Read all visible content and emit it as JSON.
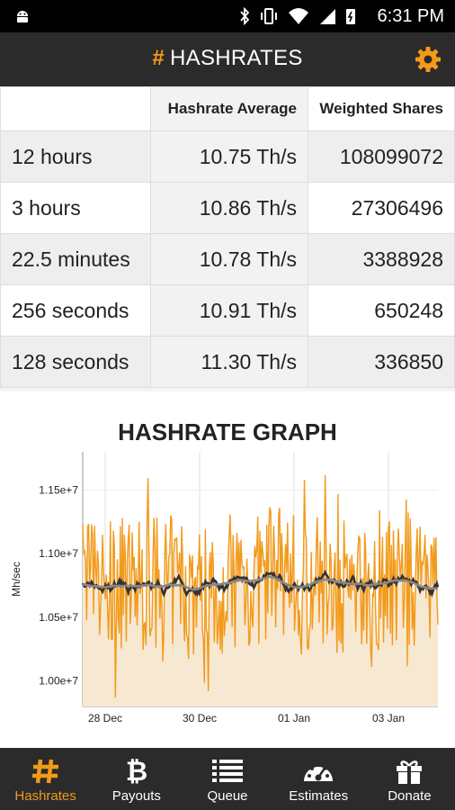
{
  "status_bar": {
    "time": "6:31 PM"
  },
  "app_bar": {
    "title": "HASHRATES",
    "title_icon": "hash"
  },
  "table": {
    "headers": [
      "",
      "Hashrate Average",
      "Weighted Shares"
    ],
    "rows": [
      {
        "period": "12 hours",
        "avg": "10.75 Th/s",
        "shares": "108099072"
      },
      {
        "period": "3 hours",
        "avg": "10.86 Th/s",
        "shares": "27306496"
      },
      {
        "period": "22.5 minutes",
        "avg": "10.78 Th/s",
        "shares": "3388928"
      },
      {
        "period": "256 seconds",
        "avg": "10.91 Th/s",
        "shares": "650248"
      },
      {
        "period": "128 seconds",
        "avg": "11.30 Th/s",
        "shares": "336850"
      }
    ]
  },
  "graph": {
    "title": "HASHRATE GRAPH"
  },
  "chart_data": {
    "type": "line",
    "ylabel": "Mh/sec",
    "ylim": [
      9800000.0,
      11800000.0
    ],
    "y_ticks": [
      "1.15e+7",
      "1.10e+7",
      "1.05e+7",
      "1.00e+7"
    ],
    "x_ticks": [
      "28 Dec",
      "30 Dec",
      "01 Jan",
      "03 Jan"
    ],
    "grid": true,
    "series": [
      {
        "color": "#f29a1a"
      },
      {
        "color": "#333333"
      },
      {
        "color": "#888888"
      }
    ]
  },
  "nav": [
    {
      "label": "Hashrates",
      "icon": "hash-icon",
      "active": true
    },
    {
      "label": "Payouts",
      "icon": "bitcoin-icon",
      "active": false
    },
    {
      "label": "Queue",
      "icon": "list-icon",
      "active": false
    },
    {
      "label": "Estimates",
      "icon": "gauge-icon",
      "active": false
    },
    {
      "label": "Donate",
      "icon": "gift-icon",
      "active": false
    }
  ]
}
